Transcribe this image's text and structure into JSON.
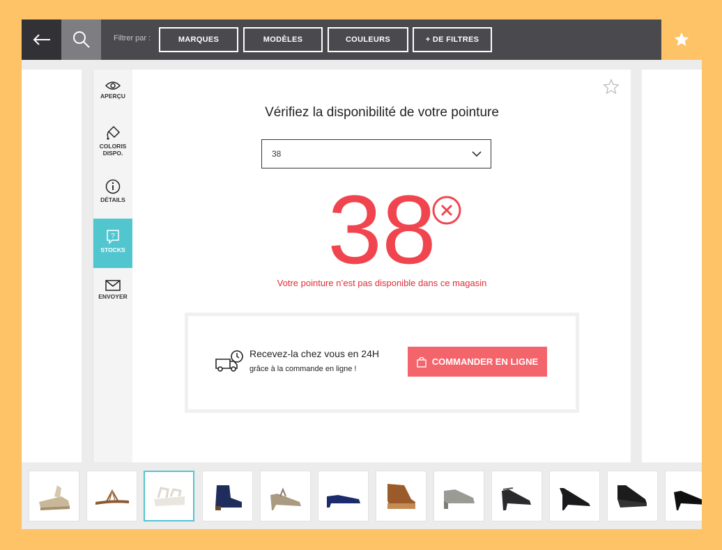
{
  "topbar": {
    "filter_label": "Filtrer par :",
    "filters": [
      "MARQUES",
      "MODÈLES",
      "COULEURS",
      "+ DE FILTRES"
    ]
  },
  "sidenav": [
    {
      "label": "APERÇU",
      "icon": "eye-icon"
    },
    {
      "label": "COLORIS DISPO.",
      "icon": "paint-bucket-icon"
    },
    {
      "label": "DÉTAILS",
      "icon": "info-icon"
    },
    {
      "label": "STOCKS",
      "icon": "stock-question-icon",
      "active": true
    },
    {
      "label": "ENVOYER",
      "icon": "envelope-icon"
    }
  ],
  "main": {
    "heading": "Vérifiez la disponibilité de votre pointure",
    "selected_size": "38",
    "big_size": "38",
    "unavailable_text": "Votre pointure n’est pas disponible dans ce magasin"
  },
  "order": {
    "title": "Recevez-la chez vous en 24H",
    "subtitle": "grâce à la commande en ligne !",
    "button_label": "COMMANDER EN LIGNE"
  },
  "colors": {
    "accent_teal": "#52c6cf",
    "alert_red": "#f0454f",
    "order_button": "#f4646b",
    "favorite_yellow": "#fdc366",
    "topbar_dark": "#4a4a4e"
  },
  "thumbnails": [
    "espadrille-sandal-beige",
    "flat-sandal-brown",
    "wedge-sandal-white",
    "ankle-boot-navy",
    "tstrap-pump-gold",
    "low-pump-navy",
    "woven-platform-sandal-tan",
    "wedge-pump-silver",
    "ankle-strap-sandal-black",
    "ankle-strap-heel-black",
    "wedge-sandal-black",
    "pump-black"
  ],
  "selected_thumbnail": 2
}
